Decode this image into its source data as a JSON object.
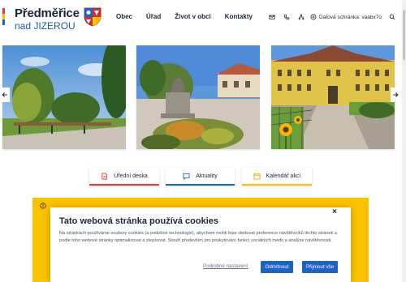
{
  "site": {
    "title": "Předměřice",
    "subtitle": "nad JIZEROU",
    "brand_colors": [
      "#e53935",
      "#fcc200",
      "#1c63c7"
    ]
  },
  "nav": {
    "items": [
      {
        "label": "Obec"
      },
      {
        "label": "Úřad"
      },
      {
        "label": "Život v obci"
      },
      {
        "label": "Kontakty"
      }
    ]
  },
  "tools": {
    "icons": [
      "mail-icon",
      "phone-icon",
      "sitemap-icon"
    ],
    "databox_label": "Datová schránka: vaabx7o",
    "search_icon": "search-icon"
  },
  "gallery": {
    "prev_icon": "arrow-left-icon",
    "next_icon": "arrow-right-icon"
  },
  "quicklinks": [
    {
      "label": "Úřední deska",
      "icon": "document-icon",
      "color": "#e53935"
    },
    {
      "label": "Aktuality",
      "icon": "chat-icon",
      "color": "#1c63c7"
    },
    {
      "label": "Kalendář akcí",
      "icon": "calendar-icon",
      "color": "#fcc200"
    }
  ],
  "cookie": {
    "title": "Tato webová stránka používá cookies",
    "text": "Na stránkách používáme soubory cookies (a podobné technologie), abychom mohli lépe sledovat preference návštěvníků těchto stránek a podle toho webové stránky optimalizovat a zlepšovat. Slouží především pro poskytování funkcí sociálních médií a analýze návštěvnosti.",
    "settings_label": "Podrobné nastavení",
    "reject_label": "Odmítnout",
    "accept_label": "Přijmout vše",
    "close_symbol": "×"
  }
}
